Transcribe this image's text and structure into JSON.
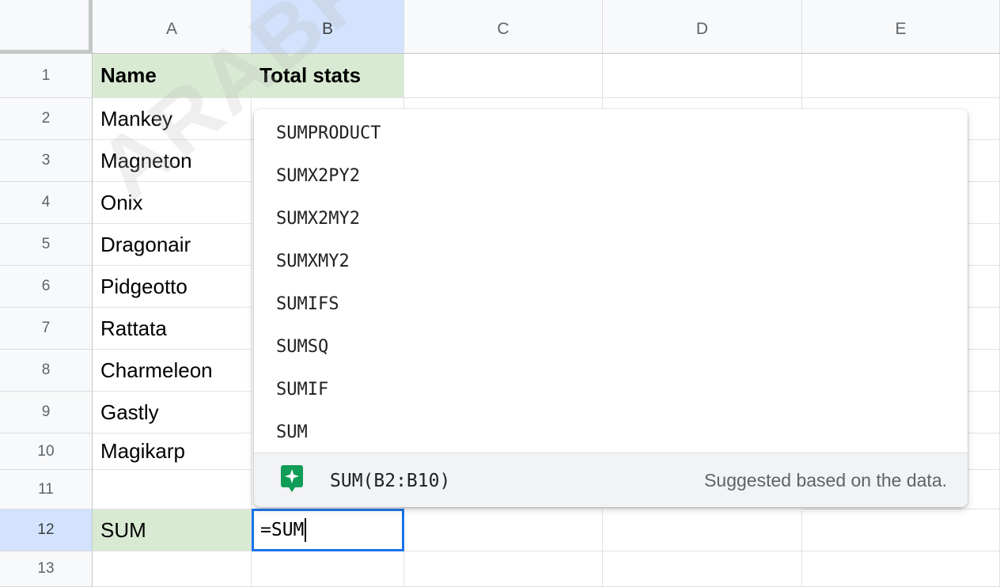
{
  "sheet": {
    "columns": [
      "A",
      "B",
      "C",
      "D",
      "E"
    ],
    "active_column": "B",
    "rows": [
      "1",
      "2",
      "3",
      "4",
      "5",
      "6",
      "7",
      "8",
      "9",
      "10",
      "11",
      "12",
      "13"
    ],
    "active_row": "12",
    "cells": {
      "A1": "Name",
      "B1": "Total stats",
      "A2": "Mankey",
      "A3": "Magneton",
      "A4": "Onix",
      "A5": "Dragonair",
      "A6": "Pidgeotto",
      "A7": "Rattata",
      "A8": "Charmeleon",
      "A9": "Gastly",
      "A10": "Magikarp",
      "A12": "SUM"
    },
    "editing_cell": {
      "ref": "B12",
      "value": "=SUM"
    },
    "header_fill_color": "#d9ead3",
    "selection_color": "#1a73e8"
  },
  "autocomplete": {
    "items": [
      "SUMPRODUCT",
      "SUMX2PY2",
      "SUMX2MY2",
      "SUMXMY2",
      "SUMIFS",
      "SUMSQ",
      "SUMIF",
      "SUM"
    ],
    "suggestion": {
      "icon": "sparkle-icon",
      "icon_color": "#0f9d58",
      "formula": "SUM(B2:B10)",
      "note": "Suggested based on the data."
    }
  },
  "watermark": "ARABPSY"
}
